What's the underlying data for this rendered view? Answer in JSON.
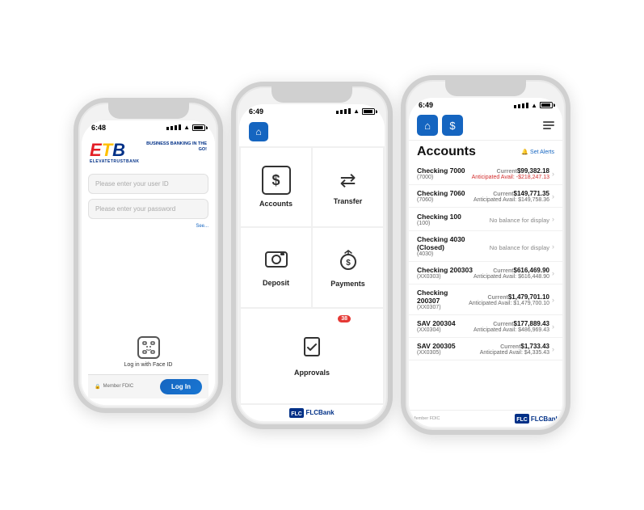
{
  "phone1": {
    "statusBar": {
      "time": "6:48"
    },
    "logo": {
      "text": "ETB",
      "tagline": "BUSINESS\nBANKING\nIN THE GO!"
    },
    "userIdPlaceholder": "Please enter your user ID",
    "passwordPlaceholder": "Please enter your password",
    "forgotLabel": "See...",
    "faceIdLabel": "Log in with Face ID",
    "fdicLabel": "Member FDIC",
    "loginButton": "Log In"
  },
  "phone2": {
    "statusBar": {
      "time": "6:49"
    },
    "menuItems": [
      {
        "id": "accounts",
        "label": "Accounts",
        "icon": "$"
      },
      {
        "id": "transfer",
        "label": "Transfer",
        "icon": "⇄"
      },
      {
        "id": "deposit",
        "label": "Deposit",
        "icon": "📷"
      },
      {
        "id": "payments",
        "label": "Payments",
        "icon": "💰"
      },
      {
        "id": "approvals",
        "label": "Approvals",
        "icon": "✓",
        "badge": "38"
      }
    ],
    "footer": "FLCBank"
  },
  "phone3": {
    "statusBar": {
      "time": "6:49"
    },
    "title": "Accounts",
    "setAlerts": "Set Alerts",
    "accounts": [
      {
        "name": "Checking 7000",
        "num": "(7000)",
        "currentLabel": "Current",
        "current": "$99,382.18",
        "availLabel": "Anticipated Avail:",
        "avail": "-$218,247.13",
        "availNegative": true,
        "noBalance": false
      },
      {
        "name": "Checking 7060",
        "num": "(7060)",
        "currentLabel": "Current",
        "current": "$149,771.35",
        "availLabel": "Anticipated Avail:",
        "avail": "$149,758.36",
        "availNegative": false,
        "noBalance": false
      },
      {
        "name": "Checking 100",
        "num": "(100)",
        "noBalanceLabel": "No balance for display",
        "noBalance": true
      },
      {
        "name": "Checking 4030 (Closed)",
        "num": "(4030)",
        "noBalanceLabel": "No balance for display",
        "noBalance": true
      },
      {
        "name": "Checking 200303",
        "num": "(XX0303)",
        "currentLabel": "Current",
        "current": "$616,469.90",
        "availLabel": "Anticipated Avail:",
        "avail": "$616,448.90",
        "availNegative": false,
        "noBalance": false
      },
      {
        "name": "Checking 200307",
        "num": "(XX0307)",
        "currentLabel": "Current",
        "current": "$1,479,701.10",
        "availLabel": "Anticipated Avail:",
        "avail": "$1,479,700.10",
        "availNegative": false,
        "noBalance": false
      },
      {
        "name": "SAV 200304",
        "num": "(XX0304)",
        "currentLabel": "Current",
        "current": "$177,889.43",
        "availLabel": "Anticipated Avail:",
        "avail": "$486,969.43",
        "availNegative": false,
        "noBalance": false
      },
      {
        "name": "SAV 200305",
        "num": "(XX0305)",
        "currentLabel": "Current",
        "current": "$1,733.43",
        "availLabel": "Anticipated Avail:",
        "avail": "$4,335.43",
        "availNegative": false,
        "noBalance": false
      }
    ],
    "footer": "FLCBank",
    "fdicLabel": "Member FDIC"
  }
}
